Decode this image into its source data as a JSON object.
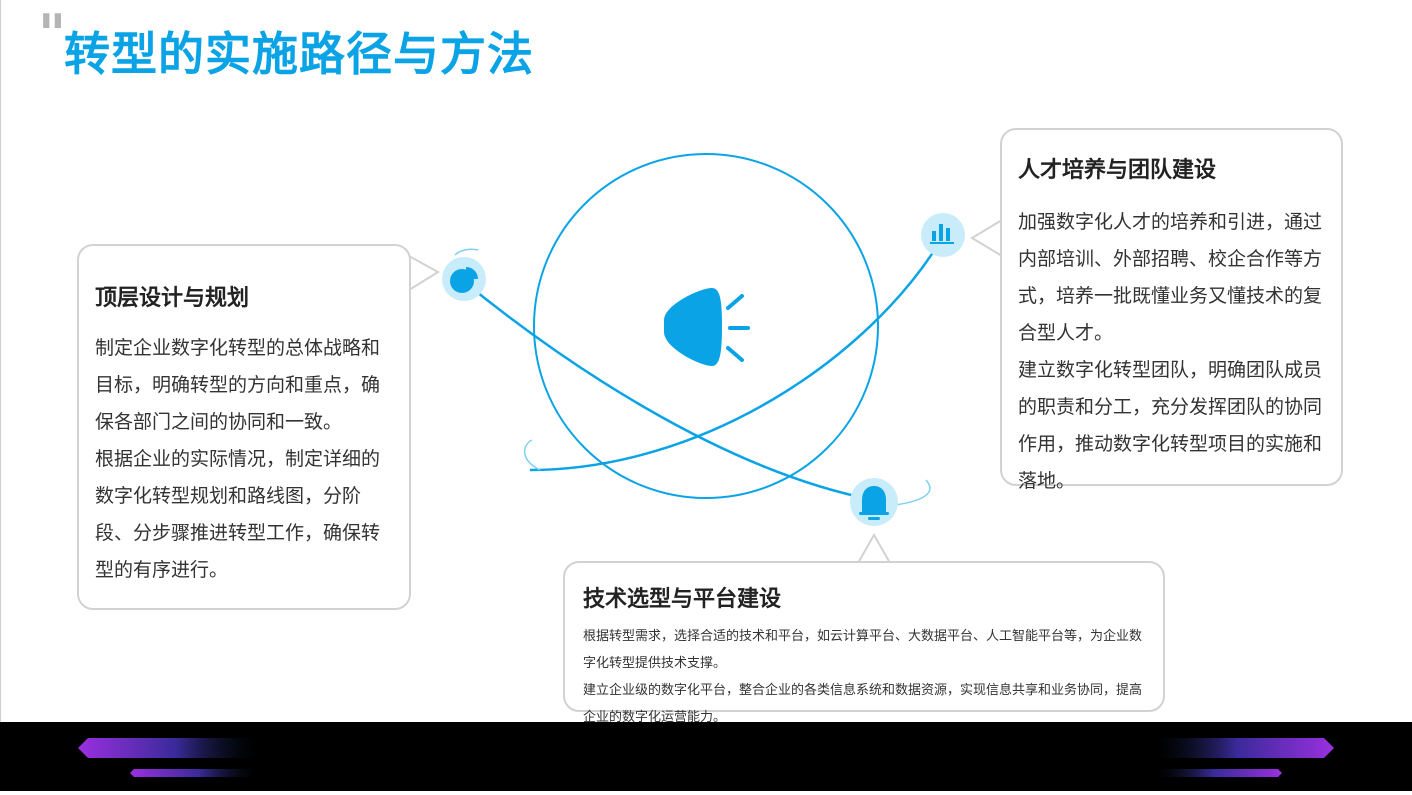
{
  "page": {
    "title": "转型的实施路径与方法",
    "quote_glyph": "\""
  },
  "cards": {
    "left": {
      "heading": "顶层设计与规划",
      "paragraphs": [
        "制定企业数字化转型的总体战略和目标，明确转型的方向和重点，确保各部门之间的协同和一致。",
        "根据企业的实际情况，制定详细的数字化转型规划和路线图，分阶段、分步骤推进转型工作，确保转型的有序进行。"
      ]
    },
    "right": {
      "heading": "人才培养与团队建设",
      "paragraphs": [
        "加强数字化人才的培养和引进，通过内部培训、外部招聘、校企合作等方式，培养一批既懂业务又懂技术的复合型人才。",
        "建立数字化转型团队，明确团队成员的职责和分工，充分发挥团队的协同作用，推动数字化转型项目的实施和落地。"
      ]
    },
    "bottom": {
      "heading": "技术选型与平台建设",
      "paragraphs": [
        "根据转型需求，选择合适的技术和平台，如云计算平台、大数据平台、人工智能平台等，为企业数字化转型提供技术支撑。",
        "建立企业级的数字化平台，整合企业的各类信息系统和数据资源，实现信息共享和业务协同，提高企业的数字化运营能力。"
      ]
    }
  },
  "icons": {
    "center": "megaphone-icon",
    "left": "pie-chart-icon",
    "right": "bar-chart-icon",
    "bottom": "bell-icon"
  },
  "colors": {
    "accent": "#0aa4e6",
    "node_bg": "#c9ecfa",
    "card_border": "#d2d2d2",
    "footer_bg": "#000000",
    "footer_gradient_start": "#8a2bd6"
  }
}
